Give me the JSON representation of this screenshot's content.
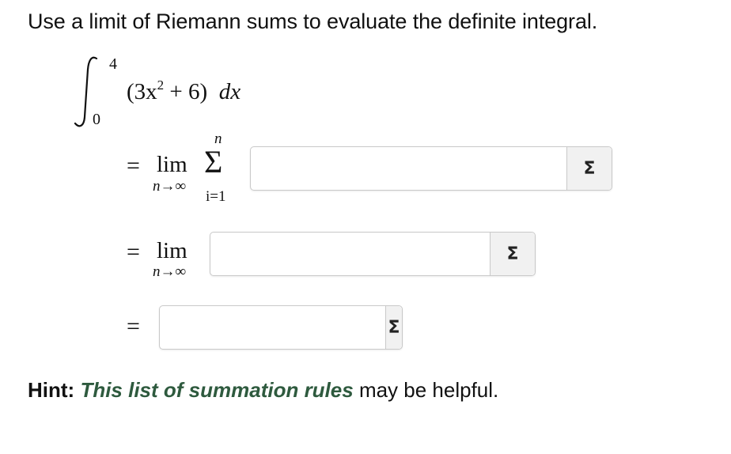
{
  "prompt": "Use a limit of Riemann sums to evaluate the definite integral.",
  "integral": {
    "upper": "4",
    "lower": "0",
    "integrand_open": "(3x",
    "integrand_exp": "2",
    "integrand_rest": " + 6)",
    "dx": "dx"
  },
  "steps": {
    "equals": "=",
    "lim": "lim",
    "limit_sub": "n→∞",
    "sigma": "Σ",
    "sum_upper": "n",
    "sum_lower": "i=1"
  },
  "answers": [
    {
      "value": "",
      "button": "Σ"
    },
    {
      "value": "",
      "button": "Σ"
    },
    {
      "value": "",
      "button": "Σ"
    }
  ],
  "hint": {
    "label": "Hint:",
    "link": "This list of summation rules",
    "rest": " may be helpful."
  }
}
